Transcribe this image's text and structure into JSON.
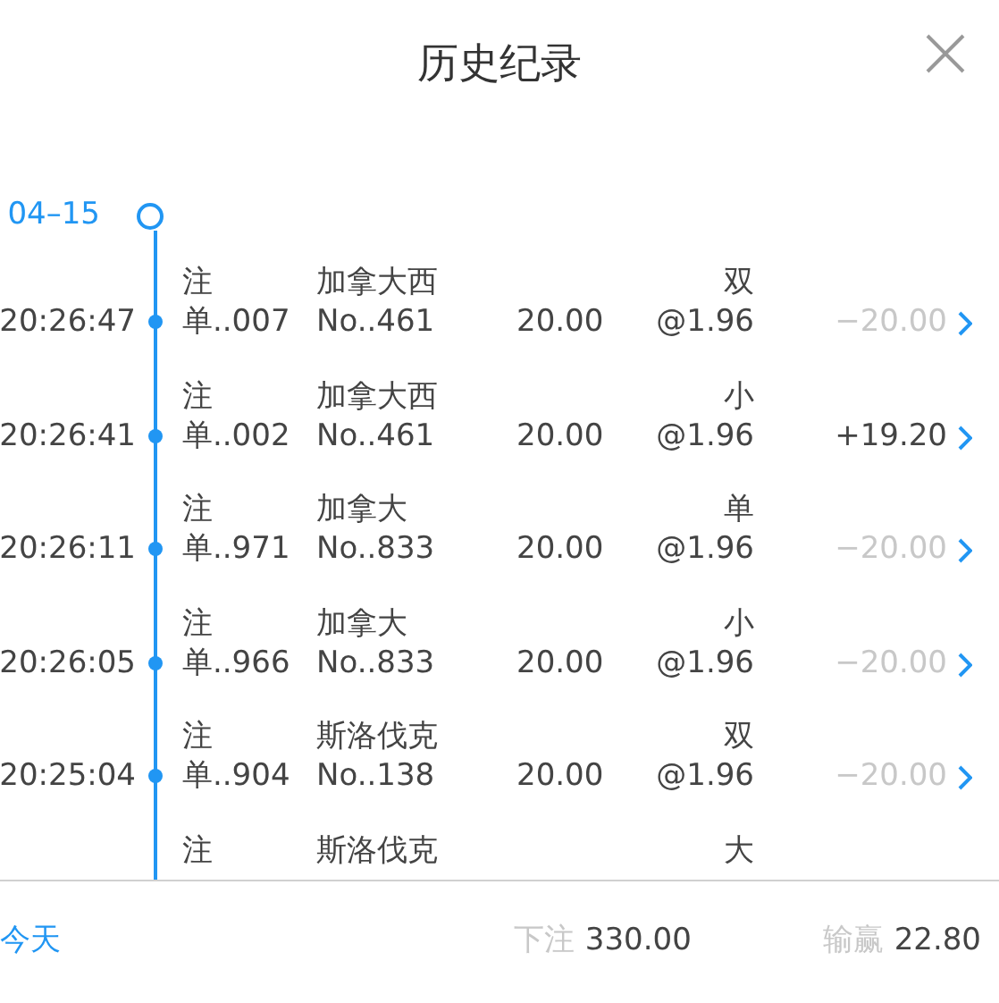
{
  "title": "历史纪录",
  "date": "04–15",
  "rows": [
    {
      "time": "20:26:47",
      "order_line1": "注",
      "order_line2": "单..007",
      "team": "加拿大西",
      "number": "No..461",
      "amount": "20.00",
      "pick": "双",
      "odds": "@1.96",
      "result": "−20.00",
      "won": false
    },
    {
      "time": "20:26:41",
      "order_line1": "注",
      "order_line2": "单..002",
      "team": "加拿大西",
      "number": "No..461",
      "amount": "20.00",
      "pick": "小",
      "odds": "@1.96",
      "result": "+19.20",
      "won": true
    },
    {
      "time": "20:26:11",
      "order_line1": "注",
      "order_line2": "单..971",
      "team": "加拿大",
      "number": "No..833",
      "amount": "20.00",
      "pick": "单",
      "odds": "@1.96",
      "result": "−20.00",
      "won": false
    },
    {
      "time": "20:26:05",
      "order_line1": "注",
      "order_line2": "单..966",
      "team": "加拿大",
      "number": "No..833",
      "amount": "20.00",
      "pick": "小",
      "odds": "@1.96",
      "result": "−20.00",
      "won": false
    },
    {
      "time": "20:25:04",
      "order_line1": "注",
      "order_line2": "单..904",
      "team": "斯洛伐克",
      "number": "No..138",
      "amount": "20.00",
      "pick": "双",
      "odds": "@1.96",
      "result": "−20.00",
      "won": false
    },
    {
      "order_line1": "注",
      "team": "斯洛伐克",
      "pick": "大"
    }
  ],
  "footer": {
    "period": "今天",
    "bet_label": "下注",
    "bet_value": "330.00",
    "win_label": "输赢",
    "win_value": "22.80"
  }
}
